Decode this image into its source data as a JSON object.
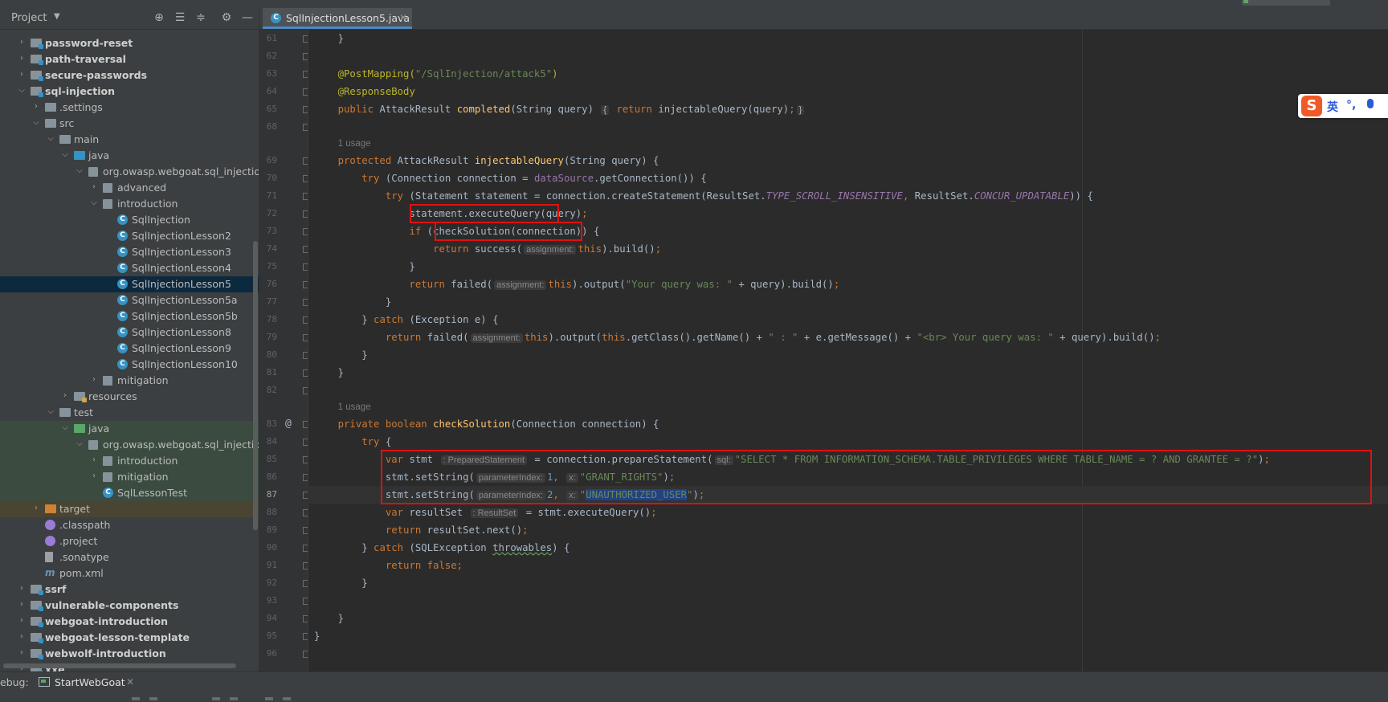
{
  "project_panel": {
    "title": "Project",
    "tree": [
      {
        "label": "password-reset",
        "depth": 0,
        "arrow": "right",
        "icon": "module",
        "bold": true
      },
      {
        "label": "path-traversal",
        "depth": 0,
        "arrow": "right",
        "icon": "module",
        "bold": true
      },
      {
        "label": "secure-passwords",
        "depth": 0,
        "arrow": "right",
        "icon": "module",
        "bold": true
      },
      {
        "label": "sql-injection",
        "depth": 0,
        "arrow": "down",
        "icon": "module",
        "bold": true
      },
      {
        "label": ".settings",
        "depth": 1,
        "arrow": "right",
        "icon": "folder"
      },
      {
        "label": "src",
        "depth": 1,
        "arrow": "down",
        "icon": "folder"
      },
      {
        "label": "main",
        "depth": 2,
        "arrow": "down",
        "icon": "folder"
      },
      {
        "label": "java",
        "depth": 3,
        "arrow": "down",
        "icon": "src"
      },
      {
        "label": "org.owasp.webgoat.sql_injection",
        "depth": 4,
        "arrow": "down",
        "icon": "pkg"
      },
      {
        "label": "advanced",
        "depth": 5,
        "arrow": "right",
        "icon": "pkg"
      },
      {
        "label": "introduction",
        "depth": 5,
        "arrow": "down",
        "icon": "pkg"
      },
      {
        "label": "SqlInjection",
        "depth": 6,
        "arrow": "",
        "icon": "class"
      },
      {
        "label": "SqlInjectionLesson2",
        "depth": 6,
        "arrow": "",
        "icon": "class"
      },
      {
        "label": "SqlInjectionLesson3",
        "depth": 6,
        "arrow": "",
        "icon": "class"
      },
      {
        "label": "SqlInjectionLesson4",
        "depth": 6,
        "arrow": "",
        "icon": "class"
      },
      {
        "label": "SqlInjectionLesson5",
        "depth": 6,
        "arrow": "",
        "icon": "class",
        "selected": true
      },
      {
        "label": "SqlInjectionLesson5a",
        "depth": 6,
        "arrow": "",
        "icon": "class"
      },
      {
        "label": "SqlInjectionLesson5b",
        "depth": 6,
        "arrow": "",
        "icon": "class"
      },
      {
        "label": "SqlInjectionLesson8",
        "depth": 6,
        "arrow": "",
        "icon": "class"
      },
      {
        "label": "SqlInjectionLesson9",
        "depth": 6,
        "arrow": "",
        "icon": "class"
      },
      {
        "label": "SqlInjectionLesson10",
        "depth": 6,
        "arrow": "",
        "icon": "class"
      },
      {
        "label": "mitigation",
        "depth": 5,
        "arrow": "right",
        "icon": "pkg"
      },
      {
        "label": "resources",
        "depth": 3,
        "arrow": "right",
        "icon": "res"
      },
      {
        "label": "test",
        "depth": 2,
        "arrow": "down",
        "icon": "folder"
      },
      {
        "label": "java",
        "depth": 3,
        "arrow": "down",
        "icon": "test",
        "test": true
      },
      {
        "label": "org.owasp.webgoat.sql_injection",
        "depth": 4,
        "arrow": "down",
        "icon": "pkg",
        "test": true
      },
      {
        "label": "introduction",
        "depth": 5,
        "arrow": "right",
        "icon": "pkg",
        "test": true
      },
      {
        "label": "mitigation",
        "depth": 5,
        "arrow": "right",
        "icon": "pkg",
        "test": true
      },
      {
        "label": "SqlLessonTest",
        "depth": 5,
        "arrow": "",
        "icon": "class",
        "test": true
      },
      {
        "label": "target",
        "depth": 1,
        "arrow": "right",
        "icon": "target",
        "target": true
      },
      {
        "label": ".classpath",
        "depth": 1,
        "arrow": "",
        "icon": "eclipse"
      },
      {
        "label": ".project",
        "depth": 1,
        "arrow": "",
        "icon": "eclipse"
      },
      {
        "label": ".sonatype",
        "depth": 1,
        "arrow": "",
        "icon": "sonatype"
      },
      {
        "label": "pom.xml",
        "depth": 1,
        "arrow": "",
        "icon": "maven"
      },
      {
        "label": "ssrf",
        "depth": 0,
        "arrow": "right",
        "icon": "module",
        "bold": true
      },
      {
        "label": "vulnerable-components",
        "depth": 0,
        "arrow": "right",
        "icon": "module",
        "bold": true
      },
      {
        "label": "webgoat-introduction",
        "depth": 0,
        "arrow": "right",
        "icon": "module",
        "bold": true
      },
      {
        "label": "webgoat-lesson-template",
        "depth": 0,
        "arrow": "right",
        "icon": "module",
        "bold": true
      },
      {
        "label": "webwolf-introduction",
        "depth": 0,
        "arrow": "right",
        "icon": "module",
        "bold": true
      },
      {
        "label": "xxe",
        "depth": 0,
        "arrow": "right",
        "icon": "module",
        "bold": true
      }
    ]
  },
  "editor": {
    "tab_label": "SqlInjectionLesson5.java",
    "current_line": "87",
    "lines": [
      {
        "no": "61",
        "segs": [
          [
            "",
            "    }"
          ]
        ]
      },
      {
        "no": "62",
        "segs": []
      },
      {
        "no": "63",
        "segs": [
          [
            "ann",
            "    @PostMapping("
          ],
          [
            "str",
            "\"/SqlInjection/attack5\""
          ],
          [
            "ann",
            ")"
          ]
        ]
      },
      {
        "no": "64",
        "segs": [
          [
            "ann",
            "    @ResponseBody"
          ]
        ]
      },
      {
        "no": "65",
        "segs": [
          [
            "kw",
            "    public "
          ],
          [
            "",
            "AttackResult "
          ],
          [
            "fn",
            "completed"
          ],
          [
            "",
            "(String query) "
          ],
          [
            "hintbox",
            "{"
          ],
          [
            "kw",
            " return "
          ],
          [
            "",
            "injectableQuery(query)"
          ],
          [
            "kw",
            ";"
          ],
          [
            "hintbox",
            "}"
          ]
        ]
      },
      {
        "no": "68",
        "segs": []
      },
      {
        "no": "",
        "usage": "1 usage"
      },
      {
        "no": "69",
        "segs": [
          [
            "kw",
            "    protected "
          ],
          [
            "",
            "AttackResult "
          ],
          [
            "fn",
            "injectableQuery"
          ],
          [
            "",
            "(String query) {"
          ]
        ]
      },
      {
        "no": "70",
        "segs": [
          [
            "kw",
            "        try "
          ],
          [
            "",
            "(Connection connection = "
          ],
          [
            "fld",
            "dataSource"
          ],
          [
            "",
            ".getConnection()) {"
          ]
        ]
      },
      {
        "no": "71",
        "segs": [
          [
            "kw",
            "            try "
          ],
          [
            "",
            "(Statement statement = connection.createStatement(ResultSet."
          ],
          [
            "ifld",
            "TYPE_SCROLL_INSENSITIVE"
          ],
          [
            "kw",
            ", "
          ],
          [
            "",
            "ResultSet."
          ],
          [
            "ifld",
            "CONCUR_UPDATABLE"
          ],
          [
            "",
            ")) {"
          ]
        ]
      },
      {
        "no": "72",
        "segs": [
          [
            "",
            "                statement.executeQuery(query)"
          ],
          [
            "kw",
            ";"
          ]
        ]
      },
      {
        "no": "73",
        "segs": [
          [
            "kw",
            "                if "
          ],
          [
            "",
            "(checkSolution(connection)) {"
          ]
        ]
      },
      {
        "no": "74",
        "segs": [
          [
            "kw",
            "                    return "
          ],
          [
            "",
            "success("
          ],
          [
            "hint",
            "assignment:"
          ],
          [
            "kw",
            "this"
          ],
          [
            "",
            ").build()"
          ],
          [
            "kw",
            ";"
          ]
        ]
      },
      {
        "no": "75",
        "segs": [
          [
            "",
            "                }"
          ]
        ]
      },
      {
        "no": "76",
        "segs": [
          [
            "kw",
            "                return "
          ],
          [
            "",
            "failed("
          ],
          [
            "hint",
            "assignment:"
          ],
          [
            "kw",
            "this"
          ],
          [
            "",
            ").output("
          ],
          [
            "str",
            "\"Your query was: \""
          ],
          [
            "",
            " + query).build()"
          ],
          [
            "kw",
            ";"
          ]
        ]
      },
      {
        "no": "77",
        "segs": [
          [
            "",
            "            }"
          ]
        ]
      },
      {
        "no": "78",
        "segs": [
          [
            "",
            "        } "
          ],
          [
            "kw",
            "catch "
          ],
          [
            "",
            "(Exception e) {"
          ]
        ]
      },
      {
        "no": "79",
        "segs": [
          [
            "kw",
            "            return "
          ],
          [
            "",
            "failed("
          ],
          [
            "hint",
            "assignment:"
          ],
          [
            "kw",
            "this"
          ],
          [
            "",
            ").output("
          ],
          [
            "kw",
            "this"
          ],
          [
            "",
            ".getClass().getName() + "
          ],
          [
            "str",
            "\" : \""
          ],
          [
            "",
            " + e.getMessage() + "
          ],
          [
            "str",
            "\"<br> Your query was: \""
          ],
          [
            "",
            " + query).build()"
          ],
          [
            "kw",
            ";"
          ]
        ]
      },
      {
        "no": "80",
        "segs": [
          [
            "",
            "        }"
          ]
        ]
      },
      {
        "no": "81",
        "segs": [
          [
            "",
            "    }"
          ]
        ]
      },
      {
        "no": "82",
        "segs": []
      },
      {
        "no": "",
        "usage": "1 usage"
      },
      {
        "no": "83",
        "at": "@",
        "segs": [
          [
            "kw",
            "    private boolean "
          ],
          [
            "fn",
            "checkSolution"
          ],
          [
            "",
            "(Connection connection) {"
          ]
        ]
      },
      {
        "no": "84",
        "segs": [
          [
            "kw",
            "        try "
          ],
          [
            "",
            "{"
          ]
        ]
      },
      {
        "no": "85",
        "segs": [
          [
            "kw",
            "            var "
          ],
          [
            "",
            "stmt "
          ],
          [
            "hint",
            ": PreparedStatement"
          ],
          [
            "",
            " = connection.prepareStatement("
          ],
          [
            "hint",
            "sql:"
          ],
          [
            "str",
            "\"SELECT * FROM INFORMATION_SCHEMA.TABLE_PRIVILEGES WHERE TABLE_NAME = ? AND GRANTEE = ?\""
          ],
          [
            "",
            ")"
          ],
          [
            "kw",
            ";"
          ]
        ]
      },
      {
        "no": "86",
        "segs": [
          [
            "",
            "            stmt.setString("
          ],
          [
            "hint",
            "parameterIndex:"
          ],
          [
            "num",
            "1"
          ],
          [
            "kw",
            ", "
          ],
          [
            "hint",
            "x:"
          ],
          [
            "str",
            "\"GRANT_RIGHTS\""
          ],
          [
            "",
            ")"
          ],
          [
            "kw",
            ";"
          ]
        ]
      },
      {
        "no": "87",
        "segs": [
          [
            "",
            "            stmt.setString("
          ],
          [
            "hint",
            "parameterIndex:"
          ],
          [
            "num",
            "2"
          ],
          [
            "kw",
            ", "
          ],
          [
            "hint",
            "x:"
          ],
          [
            "str",
            "\""
          ],
          [
            "strsel",
            "UNAUTHORIZED_USER"
          ],
          [
            "str",
            "\""
          ],
          [
            "",
            ")"
          ],
          [
            "kw",
            ";"
          ]
        ]
      },
      {
        "no": "88",
        "segs": [
          [
            "kw",
            "            var "
          ],
          [
            "",
            "resultSet "
          ],
          [
            "hint",
            ": ResultSet"
          ],
          [
            "",
            " = stmt.executeQuery()"
          ],
          [
            "kw",
            ";"
          ]
        ]
      },
      {
        "no": "89",
        "segs": [
          [
            "kw",
            "            return "
          ],
          [
            "",
            "resultSet.next()"
          ],
          [
            "kw",
            ";"
          ]
        ]
      },
      {
        "no": "90",
        "segs": [
          [
            "",
            "        } "
          ],
          [
            "kw",
            "catch "
          ],
          [
            "",
            "(SQLException "
          ],
          [
            "wavy",
            "throwables"
          ],
          [
            "",
            ") {"
          ]
        ]
      },
      {
        "no": "91",
        "segs": [
          [
            "kw",
            "            return false;"
          ]
        ]
      },
      {
        "no": "92",
        "segs": [
          [
            "",
            "        }"
          ]
        ]
      },
      {
        "no": "93",
        "segs": []
      },
      {
        "no": "94",
        "segs": [
          [
            "",
            "    }"
          ]
        ]
      },
      {
        "no": "95",
        "segs": [
          [
            "",
            "}"
          ]
        ]
      },
      {
        "no": "96",
        "segs": []
      }
    ]
  },
  "ime": {
    "label": "英",
    "punct": "°,"
  },
  "debug": {
    "label": "ebug:",
    "config": "StartWebGoat"
  },
  "colors": {
    "highlight_box": "#e01010",
    "selection": "#214283",
    "keyword": "#cc7832",
    "string": "#6a8759",
    "method": "#ffc66d"
  }
}
